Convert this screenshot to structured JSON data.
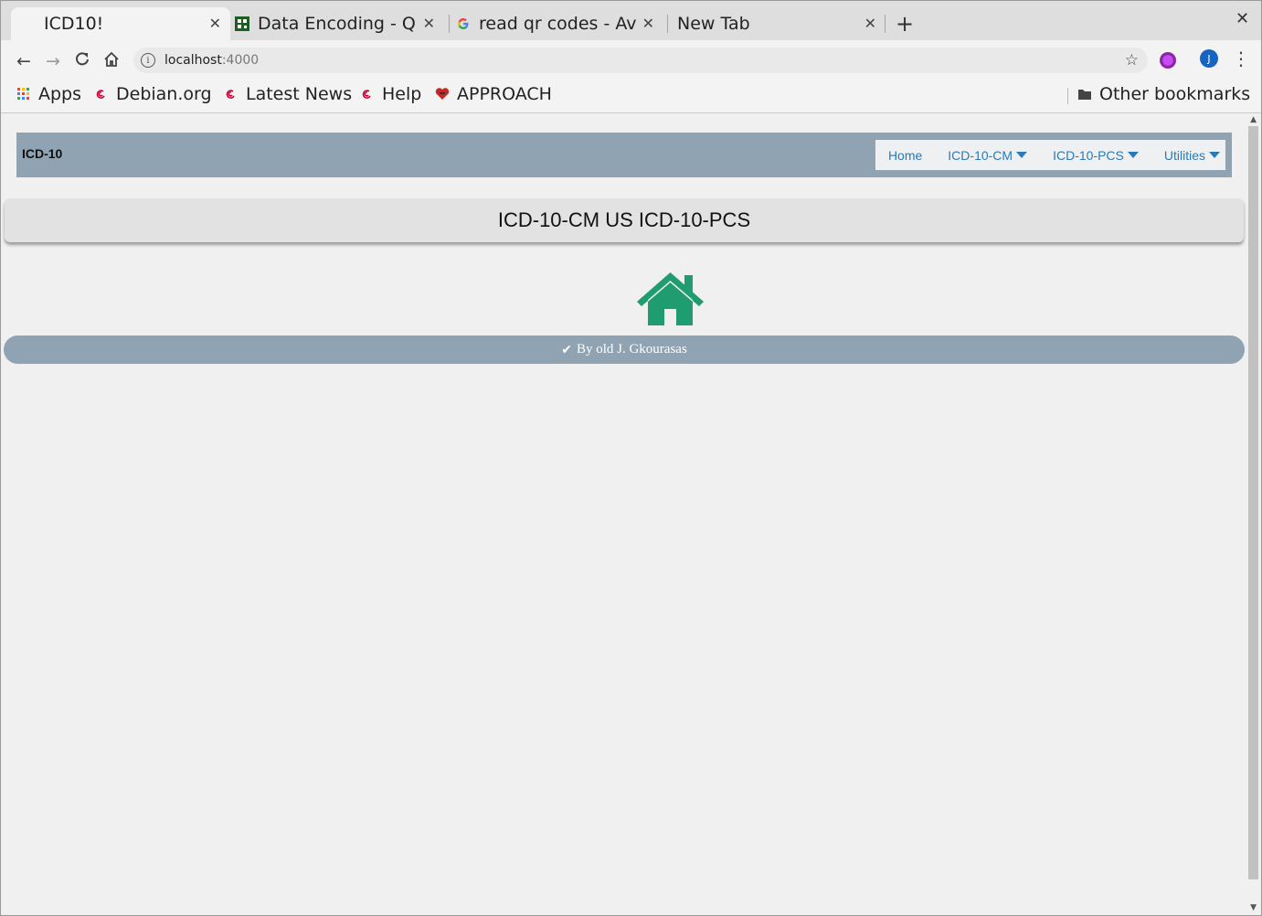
{
  "browser": {
    "tabs": [
      {
        "title": "ICD10!",
        "active": true
      },
      {
        "title": "Data Encoding - QR",
        "active": false
      },
      {
        "title": "read qr codes - Avo",
        "active": false
      },
      {
        "title": "New Tab",
        "active": false
      }
    ],
    "new_tab_label": "+",
    "close_label": "✕",
    "url_host": "localhost",
    "url_port": ":4000",
    "avatar_letter": "J",
    "bookmarks": [
      {
        "label": "Apps",
        "icon": "apps-grid-icon"
      },
      {
        "label": "Debian.org",
        "icon": "debian-swirl-icon"
      },
      {
        "label": "Latest News",
        "icon": "debian-swirl-icon"
      },
      {
        "label": "Help",
        "icon": "debian-swirl-icon"
      },
      {
        "label": "APPROACH",
        "icon": "approach-heart-icon"
      }
    ],
    "other_bookmarks": "Other bookmarks"
  },
  "page": {
    "brand": "ICD-10",
    "nav": {
      "home": "Home",
      "cm": "ICD-10-CM",
      "pcs": "ICD-10-PCS",
      "utilities": "Utilities"
    },
    "header": "ICD-10-CM US ICD-10-PCS",
    "footer_credit": "By old J. Gkourasas"
  },
  "colors": {
    "navbar_bg": "#8fa3b3",
    "link": "#2a7ab8",
    "home_icon": "#1f9c70"
  }
}
